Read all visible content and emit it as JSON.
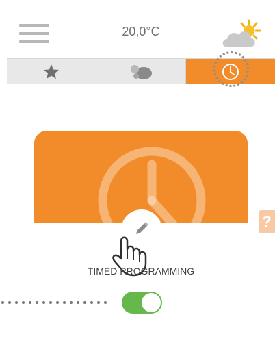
{
  "header": {
    "menu_icon": "hamburger-menu-icon",
    "temperature": "20,0°C",
    "weather_icon": "partly-cloudy-sun-icon"
  },
  "tabs": [
    {
      "icon": "star-icon",
      "active": false
    },
    {
      "icon": "scenes-icon",
      "active": false
    },
    {
      "icon": "clock-icon",
      "active": true
    }
  ],
  "colors": {
    "accent": "#f28c2b",
    "tab_inactive": "#e8e8e8",
    "toggle_on": "#67b84b",
    "help_tab": "#f7c9a4"
  },
  "program": {
    "title": "TIMED PROGRAMMING",
    "card_icon": "clock-icon",
    "edit_icon": "pencil-icon",
    "enabled": true
  },
  "help": {
    "label": "?"
  }
}
